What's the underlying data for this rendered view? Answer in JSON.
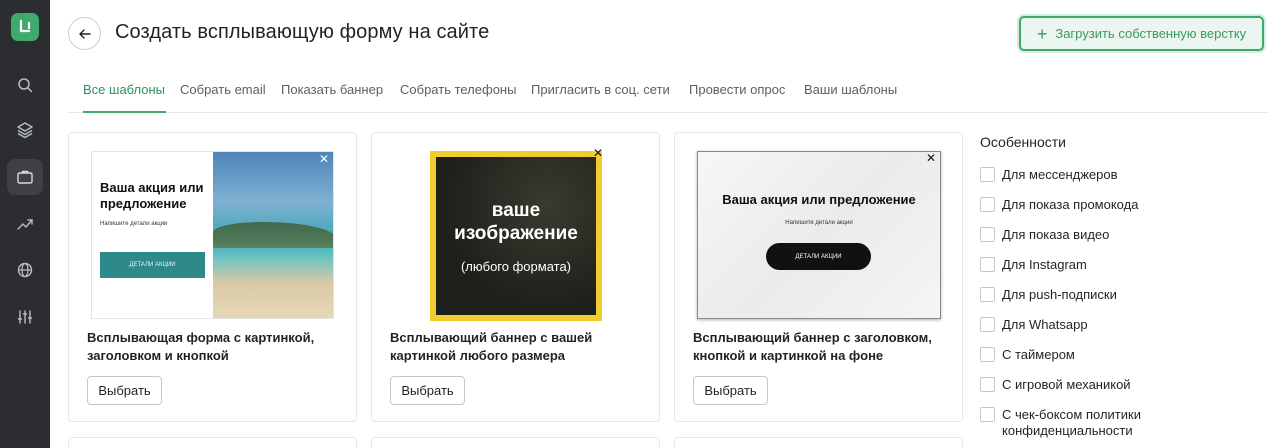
{
  "header": {
    "title": "Создать всплывающую форму на сайте",
    "upload_button": "Загрузить собственную верстку",
    "accent_color": "#3fa96e"
  },
  "tabs": [
    {
      "label": "Все шаблоны",
      "active": true
    },
    {
      "label": "Собрать email"
    },
    {
      "label": "Показать баннер"
    },
    {
      "label": "Собрать телефоны"
    },
    {
      "label": "Пригласить в соц. сети"
    },
    {
      "label": "Провести опрос"
    },
    {
      "label": "Ваши шаблоны"
    }
  ],
  "sidebar": {
    "items": [
      {
        "icon": "search-icon"
      },
      {
        "icon": "layers-icon"
      },
      {
        "icon": "briefcase-icon",
        "active": true
      },
      {
        "icon": "trending-up-icon"
      },
      {
        "icon": "globe-icon"
      },
      {
        "icon": "sliders-icon"
      }
    ]
  },
  "cards": [
    {
      "title": "Всплывающая форма с картинкой, заголовком и кнопкой",
      "button": "Выбрать",
      "preview": {
        "heading": "Ваша акция или предложение",
        "sub": "Напишите детали акции",
        "cta": "ДЕТАЛИ АКЦИИ",
        "close": "✕"
      }
    },
    {
      "title": "Всплывающий баннер с вашей картинкой любого размера",
      "button": "Выбрать",
      "preview": {
        "big": "ваше изображение",
        "small": "(любого формата)",
        "close": "✕"
      }
    },
    {
      "title": "Всплывающий баннер с заголовком, кнопкой и картинкой на фоне",
      "button": "Выбрать",
      "preview": {
        "heading": "Ваша акция или предложение",
        "sub": "Напишите детали акции",
        "cta": "ДЕТАЛИ АКЦИИ",
        "close": "✕"
      }
    }
  ],
  "features": {
    "title": "Особенности",
    "items": [
      "Для мессенджеров",
      "Для показа промокода",
      "Для показа видео",
      "Для Instagram",
      "Для push-подписки",
      "Для Whatsapp",
      "С таймером",
      "С игровой механикой",
      "С чек-боксом политики конфиденциальности"
    ]
  }
}
